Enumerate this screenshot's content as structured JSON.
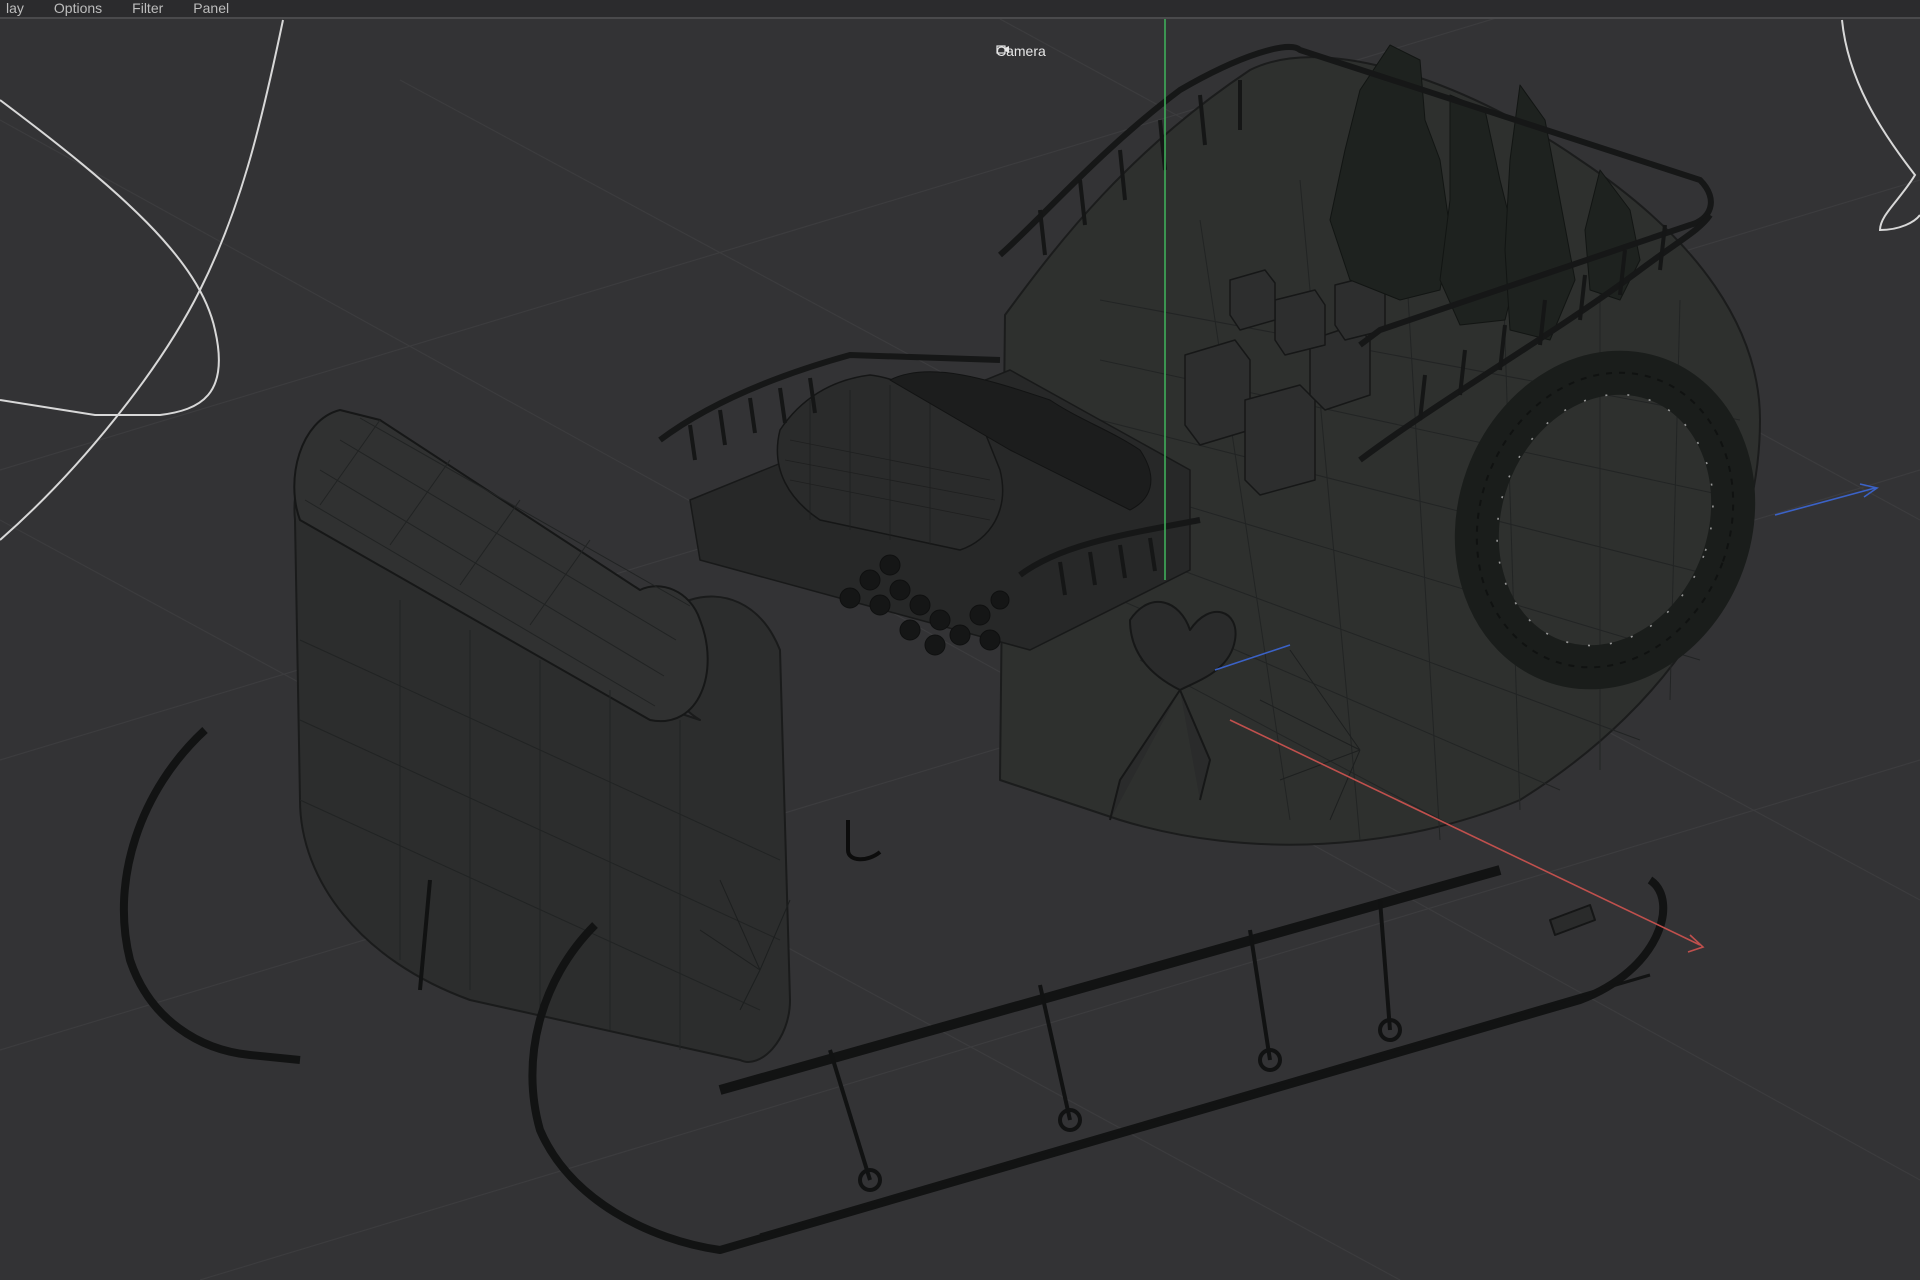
{
  "menubar": {
    "items": [
      {
        "label": "lay"
      },
      {
        "label": "Options"
      },
      {
        "label": "Filter"
      },
      {
        "label": "Panel"
      }
    ]
  },
  "viewport": {
    "camera_label": "Camera",
    "camera_icon": "camera-switch-icon",
    "background_color": "#333335"
  },
  "colors": {
    "axis_x": "#c0504d",
    "axis_y": "#3fae5a",
    "axis_z": "#3b62c7",
    "wire": "#151616",
    "spline": "#d8d8d8"
  }
}
